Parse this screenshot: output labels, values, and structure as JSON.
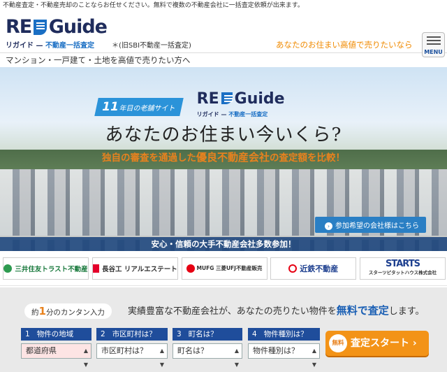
{
  "topbar": {
    "text": "不動産査定・不動産売却のことならお任せください。無料で複数の不動産会社に一括査定依頼が出来ます。"
  },
  "header": {
    "logo_text_left": "RE",
    "logo_text_right": "Guide",
    "logo_sub_left": "リガイド",
    "logo_sub_dash": "—",
    "logo_sub_right": "不動産一括査定",
    "old_name": "＊(旧SBI不動産一括査定)",
    "catch": "あなたのお住まい高値で売りたいなら",
    "menu_label": "MENU"
  },
  "subtitle": "マンション・一戸建て・土地を高値で売りたい方へ",
  "hero": {
    "badge_num": "11",
    "badge_text": "年目の老舗サイト",
    "logo_text": "RE",
    "logo_text2": "Guide",
    "logo_sub_left": "リガイド",
    "logo_sub_dash": "—",
    "logo_sub_right": "不動産一括査定",
    "title": "あなたのお住まい今いくら?",
    "sub_a": "独自の審査を通過した",
    "sub_b": "優良不動産会社",
    "sub_c": "の査定額を比較！",
    "request_button": "参加希望の会社様はこちら",
    "strip": "安心・信頼の大手不動産会社多数参加！"
  },
  "partners": [
    {
      "name": "三井住友トラスト不動産"
    },
    {
      "name": "長谷工 リアルエステート"
    },
    {
      "name": "MUFG 三菱UFJ不動産販売"
    },
    {
      "name": "近鉄不動産"
    },
    {
      "name": "STARTS",
      "sub": "スターツピタットハウス株式会社"
    }
  ],
  "form": {
    "steps_pre": "約",
    "steps_num": "1",
    "steps_post": "分のカンタン入力",
    "catch_a": "実績豊富な不動産会社が、あなたの売りたい物件を",
    "catch_em": "無料で査定",
    "catch_b": "します。",
    "fields": [
      {
        "num": "1",
        "label": "物件の地域",
        "value": "都道府県"
      },
      {
        "num": "2",
        "label": "市区町村は？",
        "value": "市区町村は？"
      },
      {
        "num": "3",
        "label": "町名は？",
        "value": "町名は？"
      },
      {
        "num": "4",
        "label": "物件種別は？",
        "value": "物件種別は？"
      }
    ],
    "submit_free": "無料",
    "submit_label": "査定スタート ›"
  },
  "colors": {
    "brand_navy": "#1f2c5c",
    "accent_orange": "#f08a00",
    "field_blue": "#1f4d9b"
  }
}
